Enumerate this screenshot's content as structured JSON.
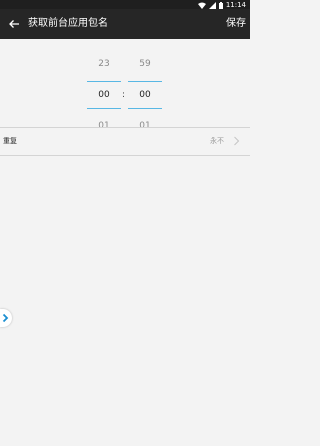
{
  "status_bar": {
    "time": "11:14"
  },
  "app_bar": {
    "title": "获取前台应用包名",
    "save_label": "保存"
  },
  "picker": {
    "hours": {
      "prev": "23",
      "selected": "00",
      "next": "01"
    },
    "separator": ":",
    "minutes": {
      "prev": "59",
      "selected": "00",
      "next": "01"
    }
  },
  "repeat": {
    "label": "重复",
    "value": "永不"
  },
  "icons": {
    "back": "arrow-left-icon",
    "chevron": "chevron-right-icon",
    "side_handle": "chevron-right-icon"
  },
  "colors": {
    "accent": "#58b7e4",
    "app_bar": "#262626"
  }
}
